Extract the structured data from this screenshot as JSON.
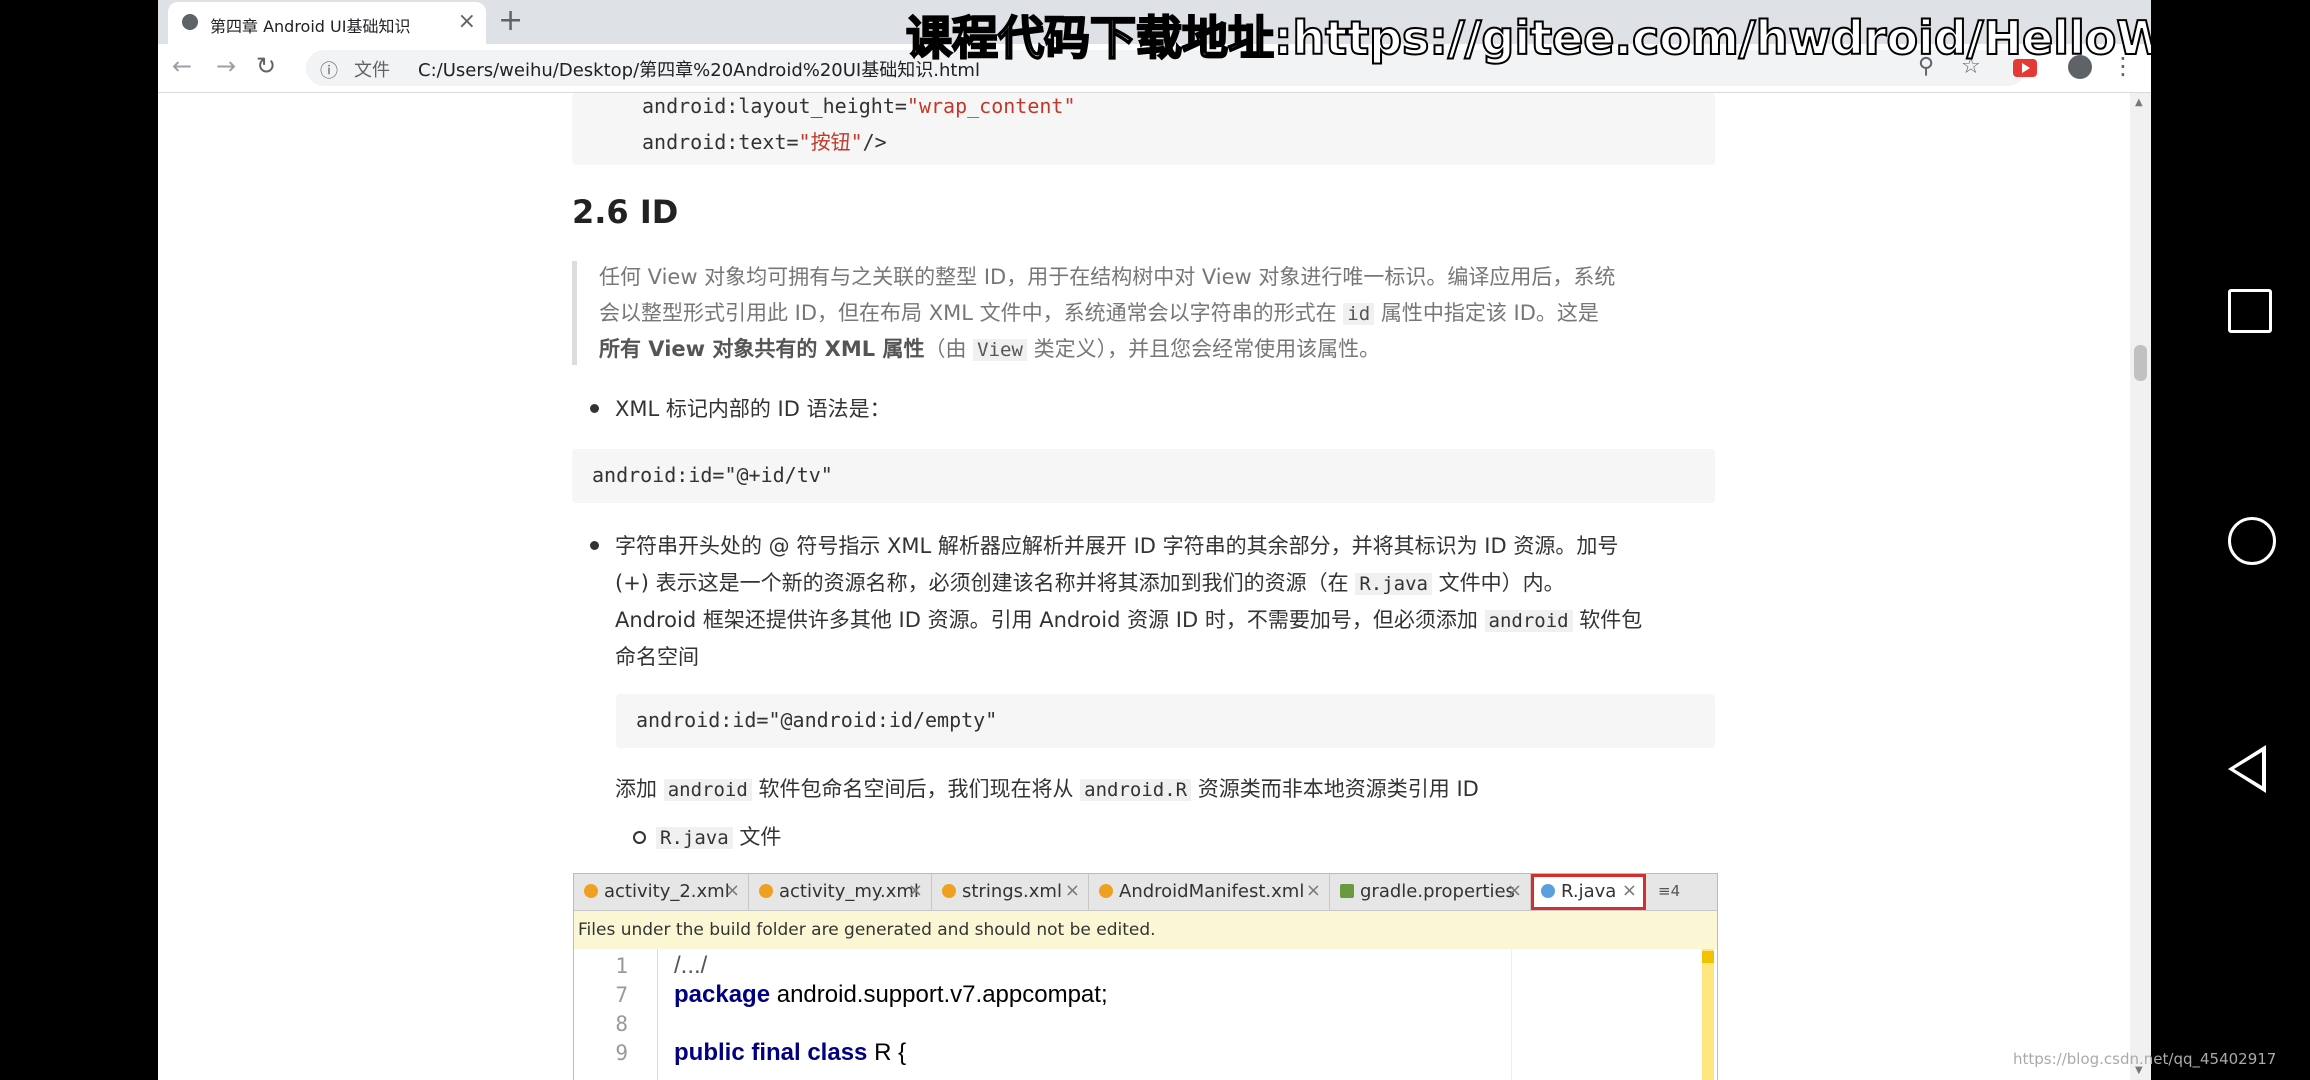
{
  "browser": {
    "tab_title": "第四章 Android UI基础知识",
    "tab_close": "×",
    "new_tab": "+",
    "omnibox_label": "文件",
    "url": "C:/Users/weihu/Desktop/第四章%20Android%20UI基础知识.html"
  },
  "overlay_banner": "课程代码下载地址:https://gitee.com/hwdroid/HelloWorld",
  "doc": {
    "code_top": {
      "line1_attr": "android:layout_height=",
      "line1_value": "\"wrap_content\"",
      "line2_attr": "android:text=",
      "line2_value": "\"按钮\"",
      "line2_end": "/>"
    },
    "heading": "2.6 ID",
    "quote": {
      "line1": "任何 View 对象均可拥有与之关联的整型 ID，用于在结构树中对 View 对象进行唯一标识。编译应用后，系统",
      "line2_a": "会以整型形式引用此 ID，但在布局 XML 文件中，系统通常会以字符串的形式在",
      "line2_code": "id",
      "line2_b": "属性中指定该 ID。这是",
      "line3_bold": "所有 View 对象共有的 XML 属性",
      "line3_a": "（由",
      "line3_code": "View",
      "line3_b": "类定义），并且您会经常使用该属性。"
    },
    "bullet1": "XML 标记内部的 ID 语法是：",
    "code_id": "android:id=\"@+id/tv\"",
    "bullet2": {
      "line1": "字符串开头处的 @ 符号指示 XML 解析器应解析并展开 ID 字符串的其余部分，并将其标识为 ID 资源。加号",
      "line2_a": "(+) 表示这是一个新的资源名称，必须创建该名称并将其添加到我们的资源（在",
      "line2_code": "R.java",
      "line2_b": "文件中）内。",
      "line3_a": "Android 框架还提供许多其他 ID 资源。引用 Android 资源 ID 时，不需要加号，但必须添加",
      "line3_code": "android",
      "line3_b": "软件包",
      "line4": "命名空间"
    },
    "code_empty": "android:id=\"@android:id/empty\"",
    "para": {
      "a": "添加",
      "code1": "android",
      "b": "软件包命名空间后，我们现在将从",
      "code2": "android.R",
      "c": "资源类而非本地资源类引用 ID"
    },
    "sub_bullet_code": "R.java",
    "sub_bullet_text": "文件"
  },
  "ide": {
    "tabs": [
      "activity_2.xml",
      "activity_my.xml",
      "strings.xml",
      "AndroidManifest.xml",
      "gradle.properties",
      "R.java"
    ],
    "tab_close": "×",
    "tab_overflow": "≡4",
    "warning": "Files under the build folder are generated and should not be edited.",
    "lines": [
      {
        "no": "1",
        "text": "/.../"
      },
      {
        "no": "7",
        "kw": "package",
        "text": " android.support.v7.appcompat;"
      },
      {
        "no": "8",
        "text": ""
      },
      {
        "no": "9",
        "kw": "public final class",
        "text": " R {"
      }
    ]
  },
  "watermark": "https://blog.csdn.net/qq_45402917"
}
